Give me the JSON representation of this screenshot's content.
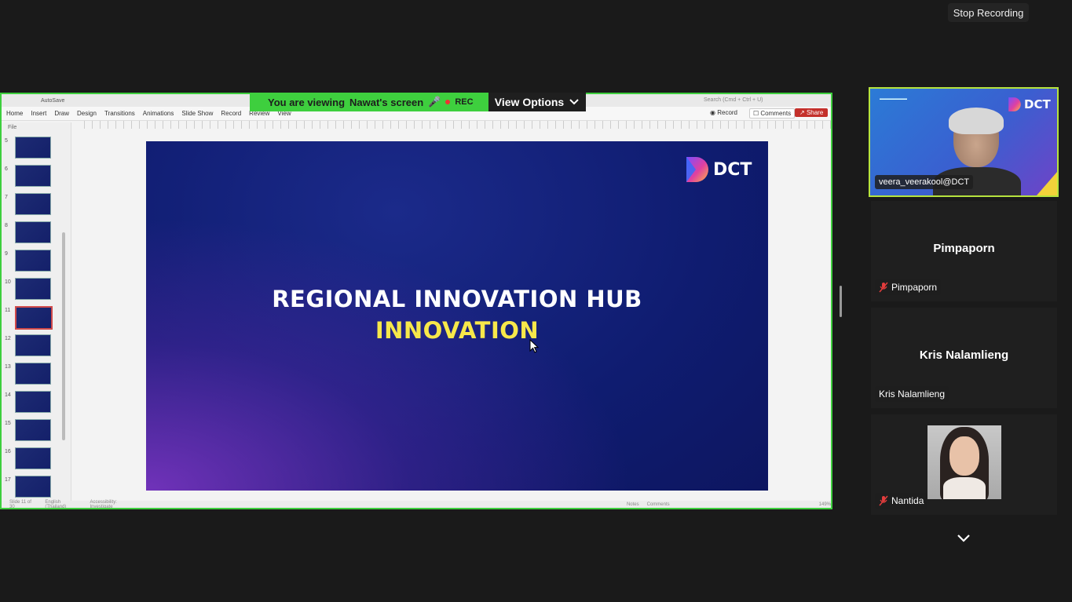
{
  "top_bar": {
    "stop_recording_label": "Stop Recording"
  },
  "banner": {
    "viewing_prefix": "You are viewing",
    "viewing_name": "Nawat's screen",
    "rec_label": "REC",
    "view_options_label": "View Options"
  },
  "powerpoint": {
    "autosave": "AutoSave",
    "search_placeholder": "Search (Cmd + Ctrl + U)",
    "tabs": [
      "Home",
      "Insert",
      "Draw",
      "Design",
      "Transitions",
      "Animations",
      "Slide Show",
      "Record",
      "Review",
      "View"
    ],
    "record_label": "Record",
    "comments_label": "Comments",
    "share_label": "Share",
    "file_label": "File",
    "thumbnail_numbers": [
      "5",
      "6",
      "7",
      "8",
      "9",
      "10",
      "11",
      "12",
      "13",
      "14",
      "15",
      "16",
      "17"
    ],
    "selected_slide": "11",
    "status_slide": "Slide 11 of 30",
    "status_language": "English (Thailand)",
    "status_accessibility": "Accessibility: Investigate",
    "status_notes": "Notes",
    "status_comments": "Comments",
    "zoom": "149%"
  },
  "slide": {
    "title_line1": "REGIONAL INNOVATION HUB",
    "title_line2": "INNOVATION",
    "logo_text": "DCT",
    "accent_yellow": "#f7e84a",
    "background": "#0f1c70"
  },
  "participants": [
    {
      "name": "veera_veerakool@DCT",
      "video": true,
      "muted": false,
      "speaking": true
    },
    {
      "name": "Pimpaporn",
      "video": false,
      "muted": true
    },
    {
      "name": "Kris Nalamlieng",
      "video": false,
      "muted": false
    },
    {
      "name": "Nantida",
      "video": true,
      "muted": true
    }
  ],
  "colors": {
    "share_border": "#3ecf3e",
    "active_speaker_border": "#b6e33e",
    "muted_icon": "#e33c3c"
  },
  "icons": [
    "chevron-down-icon",
    "mic-muted-icon",
    "record-dot-icon",
    "comments-icon",
    "share-icon",
    "cursor-icon"
  ]
}
